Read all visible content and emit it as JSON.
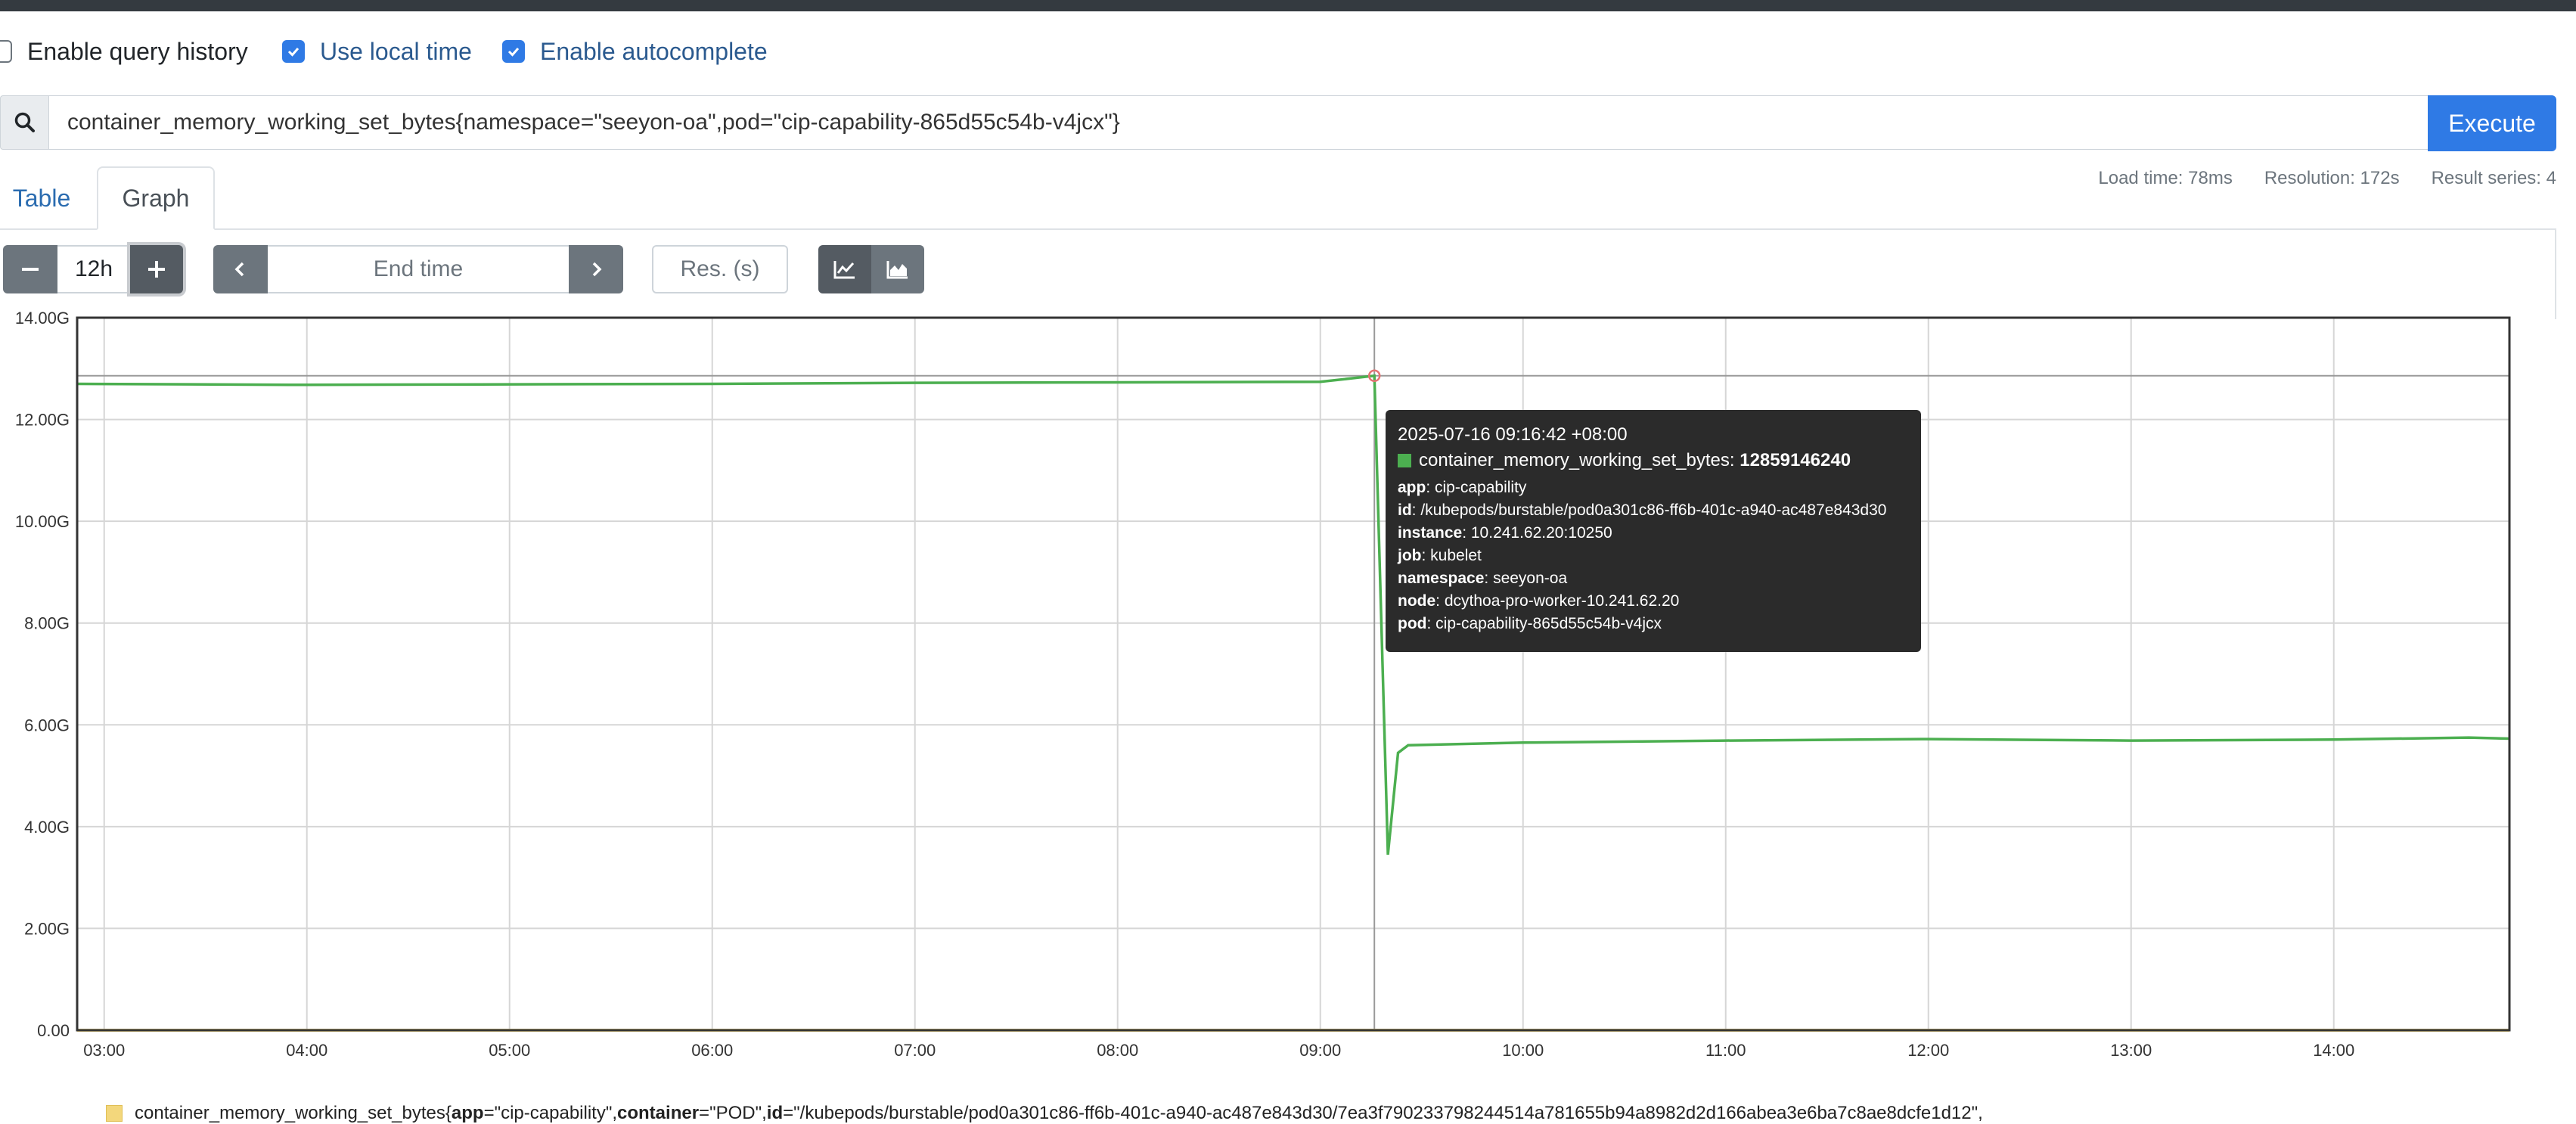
{
  "options": {
    "query_history": {
      "label": "Enable query history",
      "checked": false
    },
    "local_time": {
      "label": "Use local time",
      "checked": true
    },
    "autocomplete": {
      "label": "Enable autocomplete",
      "checked": true
    }
  },
  "query": {
    "expression": "container_memory_working_set_bytes{namespace=\"seeyon-oa\",pod=\"cip-capability-865d55c54b-v4jcx\"}",
    "execute_label": "Execute"
  },
  "tabs": [
    {
      "label": "Table",
      "active": false
    },
    {
      "label": "Graph",
      "active": true
    }
  ],
  "stats": {
    "load_time": "Load time: 78ms",
    "resolution": "Resolution: 172s",
    "result_series": "Result series: 4"
  },
  "graph_controls": {
    "range": "12h",
    "end_time_placeholder": "End time",
    "resolution_placeholder": "Res. (s)"
  },
  "chart_data": {
    "type": "line",
    "y_ticks": [
      "14.00G",
      "12.00G",
      "10.00G",
      "8.00G",
      "6.00G",
      "4.00G",
      "2.00G",
      "0.00"
    ],
    "x_ticks": [
      "03:00",
      "04:00",
      "05:00",
      "06:00",
      "07:00",
      "08:00",
      "09:00",
      "10:00",
      "11:00",
      "12:00",
      "13:00",
      "14:00"
    ],
    "ylim": [
      0,
      14000000000
    ],
    "xlim": [
      "02:52",
      "14:52"
    ],
    "grid": true,
    "series": [
      {
        "color": "#4caf50",
        "points": [
          [
            "02:52",
            12700000000
          ],
          [
            "04:00",
            12680000000
          ],
          [
            "05:00",
            12690000000
          ],
          [
            "06:00",
            12700000000
          ],
          [
            "07:00",
            12720000000
          ],
          [
            "08:00",
            12730000000
          ],
          [
            "09:00",
            12740000000
          ],
          [
            "09:16",
            12859146240
          ],
          [
            "09:20",
            3450000000
          ],
          [
            "09:23",
            5450000000
          ],
          [
            "09:26",
            5600000000
          ],
          [
            "10:00",
            5650000000
          ],
          [
            "11:00",
            5690000000
          ],
          [
            "12:00",
            5720000000
          ],
          [
            "13:00",
            5690000000
          ],
          [
            "14:00",
            5710000000
          ],
          [
            "14:40",
            5750000000
          ],
          [
            "14:52",
            5730000000
          ]
        ]
      },
      {
        "color": "#f3d77c",
        "points": [
          [
            "02:52",
            0
          ],
          [
            "14:52",
            0
          ]
        ]
      }
    ]
  },
  "tooltip": {
    "time": "2025-07-16 09:16:42 +08:00",
    "metric": "container_memory_working_set_bytes",
    "value": "12859146240",
    "labels": [
      {
        "key": "app",
        "value": "cip-capability"
      },
      {
        "key": "id",
        "value": "/kubepods/burstable/pod0a301c86-ff6b-401c-a940-ac487e843d30"
      },
      {
        "key": "instance",
        "value": "10.241.62.20:10250"
      },
      {
        "key": "job",
        "value": "kubelet"
      },
      {
        "key": "namespace",
        "value": "seeyon-oa"
      },
      {
        "key": "node",
        "value": "dcythoa-pro-worker-10.241.62.20"
      },
      {
        "key": "pod",
        "value": "cip-capability-865d55c54b-v4jcx"
      }
    ]
  },
  "legend": {
    "metric": "container_memory_working_set_bytes{",
    "app_key": "app",
    "app_val": "=\"cip-capability\", ",
    "container_key": "container",
    "container_val": "=\"POD\", ",
    "id_key": "id",
    "id_val": "=\"/kubepods/burstable/pod0a301c86-ff6b-401c-a940-ac487e843d30/7ea3f790233798244514a781655b94a8982d2d166abea3e6ba7c8ae8dcfe1d12\","
  }
}
